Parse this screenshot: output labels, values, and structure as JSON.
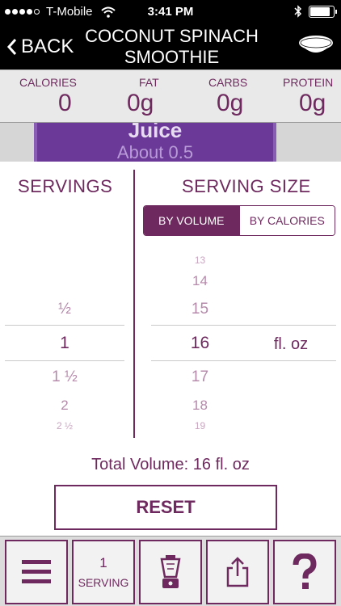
{
  "status_bar": {
    "carrier": "T-Mobile",
    "time": "3:41 PM"
  },
  "nav": {
    "back_label": "BACK",
    "title_line1": "COCONUT SPINACH",
    "title_line2": "SMOOTHIE"
  },
  "nutrition": {
    "calories_label": "CALORIES",
    "calories_value": "0",
    "fat_label": "FAT",
    "fat_value": "0g",
    "carbs_label": "CARBS",
    "carbs_value": "0g",
    "protein_label": "PROTEIN",
    "protein_value": "0g"
  },
  "image_strip": {
    "title": "Juice",
    "subtitle": "About 0.5"
  },
  "servings": {
    "header": "SERVINGS",
    "options": [
      "½",
      "1",
      "1 ½",
      "2",
      "2 ½"
    ],
    "selected": "1"
  },
  "serving_size": {
    "header": "SERVING SIZE",
    "tab_volume": "BY VOLUME",
    "tab_calories": "BY CALORIES",
    "active_tab": "BY VOLUME",
    "options": [
      "13",
      "14",
      "15",
      "16",
      "17",
      "18",
      "19"
    ],
    "selected": "16",
    "unit": "fl. oz"
  },
  "total_volume": "Total Volume: 16 fl. oz",
  "reset_label": "RESET",
  "toolbar": {
    "serving_count": "1",
    "serving_label": "SERVING"
  },
  "colors": {
    "accent": "#6e2a5f",
    "nav_bg": "#000000",
    "panel_bg": "#e9e9e9"
  }
}
